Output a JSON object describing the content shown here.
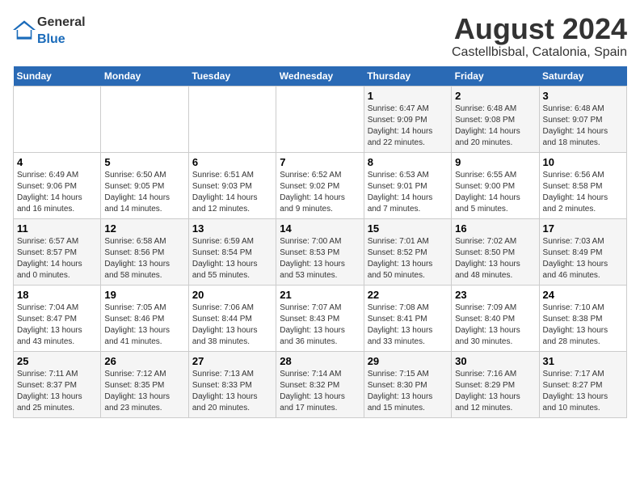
{
  "header": {
    "logo_general": "General",
    "logo_blue": "Blue",
    "month_title": "August 2024",
    "location": "Castellbisbal, Catalonia, Spain"
  },
  "weekdays": [
    "Sunday",
    "Monday",
    "Tuesday",
    "Wednesday",
    "Thursday",
    "Friday",
    "Saturday"
  ],
  "weeks": [
    [
      {
        "day": "",
        "info": ""
      },
      {
        "day": "",
        "info": ""
      },
      {
        "day": "",
        "info": ""
      },
      {
        "day": "",
        "info": ""
      },
      {
        "day": "1",
        "info": "Sunrise: 6:47 AM\nSunset: 9:09 PM\nDaylight: 14 hours and 22 minutes."
      },
      {
        "day": "2",
        "info": "Sunrise: 6:48 AM\nSunset: 9:08 PM\nDaylight: 14 hours and 20 minutes."
      },
      {
        "day": "3",
        "info": "Sunrise: 6:48 AM\nSunset: 9:07 PM\nDaylight: 14 hours and 18 minutes."
      }
    ],
    [
      {
        "day": "4",
        "info": "Sunrise: 6:49 AM\nSunset: 9:06 PM\nDaylight: 14 hours and 16 minutes."
      },
      {
        "day": "5",
        "info": "Sunrise: 6:50 AM\nSunset: 9:05 PM\nDaylight: 14 hours and 14 minutes."
      },
      {
        "day": "6",
        "info": "Sunrise: 6:51 AM\nSunset: 9:03 PM\nDaylight: 14 hours and 12 minutes."
      },
      {
        "day": "7",
        "info": "Sunrise: 6:52 AM\nSunset: 9:02 PM\nDaylight: 14 hours and 9 minutes."
      },
      {
        "day": "8",
        "info": "Sunrise: 6:53 AM\nSunset: 9:01 PM\nDaylight: 14 hours and 7 minutes."
      },
      {
        "day": "9",
        "info": "Sunrise: 6:55 AM\nSunset: 9:00 PM\nDaylight: 14 hours and 5 minutes."
      },
      {
        "day": "10",
        "info": "Sunrise: 6:56 AM\nSunset: 8:58 PM\nDaylight: 14 hours and 2 minutes."
      }
    ],
    [
      {
        "day": "11",
        "info": "Sunrise: 6:57 AM\nSunset: 8:57 PM\nDaylight: 14 hours and 0 minutes."
      },
      {
        "day": "12",
        "info": "Sunrise: 6:58 AM\nSunset: 8:56 PM\nDaylight: 13 hours and 58 minutes."
      },
      {
        "day": "13",
        "info": "Sunrise: 6:59 AM\nSunset: 8:54 PM\nDaylight: 13 hours and 55 minutes."
      },
      {
        "day": "14",
        "info": "Sunrise: 7:00 AM\nSunset: 8:53 PM\nDaylight: 13 hours and 53 minutes."
      },
      {
        "day": "15",
        "info": "Sunrise: 7:01 AM\nSunset: 8:52 PM\nDaylight: 13 hours and 50 minutes."
      },
      {
        "day": "16",
        "info": "Sunrise: 7:02 AM\nSunset: 8:50 PM\nDaylight: 13 hours and 48 minutes."
      },
      {
        "day": "17",
        "info": "Sunrise: 7:03 AM\nSunset: 8:49 PM\nDaylight: 13 hours and 46 minutes."
      }
    ],
    [
      {
        "day": "18",
        "info": "Sunrise: 7:04 AM\nSunset: 8:47 PM\nDaylight: 13 hours and 43 minutes."
      },
      {
        "day": "19",
        "info": "Sunrise: 7:05 AM\nSunset: 8:46 PM\nDaylight: 13 hours and 41 minutes."
      },
      {
        "day": "20",
        "info": "Sunrise: 7:06 AM\nSunset: 8:44 PM\nDaylight: 13 hours and 38 minutes."
      },
      {
        "day": "21",
        "info": "Sunrise: 7:07 AM\nSunset: 8:43 PM\nDaylight: 13 hours and 36 minutes."
      },
      {
        "day": "22",
        "info": "Sunrise: 7:08 AM\nSunset: 8:41 PM\nDaylight: 13 hours and 33 minutes."
      },
      {
        "day": "23",
        "info": "Sunrise: 7:09 AM\nSunset: 8:40 PM\nDaylight: 13 hours and 30 minutes."
      },
      {
        "day": "24",
        "info": "Sunrise: 7:10 AM\nSunset: 8:38 PM\nDaylight: 13 hours and 28 minutes."
      }
    ],
    [
      {
        "day": "25",
        "info": "Sunrise: 7:11 AM\nSunset: 8:37 PM\nDaylight: 13 hours and 25 minutes."
      },
      {
        "day": "26",
        "info": "Sunrise: 7:12 AM\nSunset: 8:35 PM\nDaylight: 13 hours and 23 minutes."
      },
      {
        "day": "27",
        "info": "Sunrise: 7:13 AM\nSunset: 8:33 PM\nDaylight: 13 hours and 20 minutes."
      },
      {
        "day": "28",
        "info": "Sunrise: 7:14 AM\nSunset: 8:32 PM\nDaylight: 13 hours and 17 minutes."
      },
      {
        "day": "29",
        "info": "Sunrise: 7:15 AM\nSunset: 8:30 PM\nDaylight: 13 hours and 15 minutes."
      },
      {
        "day": "30",
        "info": "Sunrise: 7:16 AM\nSunset: 8:29 PM\nDaylight: 13 hours and 12 minutes."
      },
      {
        "day": "31",
        "info": "Sunrise: 7:17 AM\nSunset: 8:27 PM\nDaylight: 13 hours and 10 minutes."
      }
    ]
  ]
}
